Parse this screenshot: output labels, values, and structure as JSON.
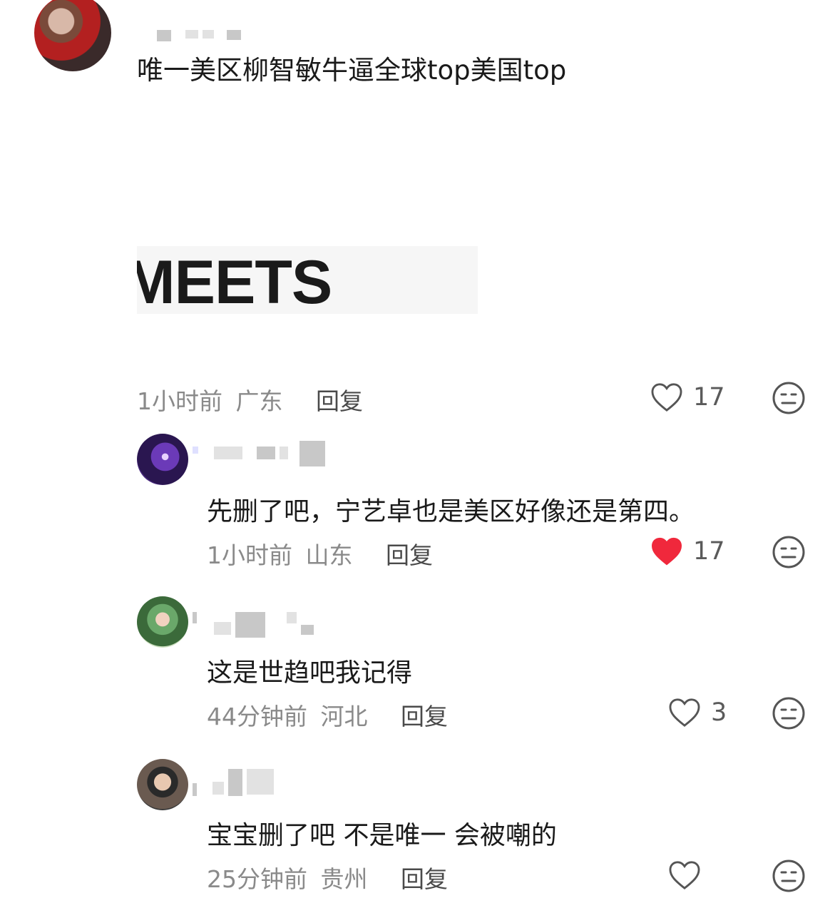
{
  "main_comment": {
    "text": "唯一美区柳智敏牛逼全球top美国top",
    "image_text": "MEETS KAR",
    "time": "1小时前",
    "location": "广东",
    "reply_label": "回复",
    "likes": "17",
    "liked": false
  },
  "replies": [
    {
      "text": "先删了吧，宁艺卓也是美区好像还是第四。",
      "time": "1小时前",
      "location": "山东",
      "reply_label": "回复",
      "likes": "17",
      "liked": true
    },
    {
      "text": "这是世趋吧我记得",
      "time": "44分钟前",
      "location": "河北",
      "reply_label": "回复",
      "likes": "3",
      "liked": false
    },
    {
      "text": "宝宝删了吧 不是唯一 会被嘲的",
      "time": "25分钟前",
      "location": "贵州",
      "reply_label": "回复",
      "likes": "",
      "liked": false
    }
  ],
  "icons": {
    "like": "heart-outline-icon",
    "liked": "heart-filled-icon",
    "dislike": "meh-face-icon"
  },
  "colors": {
    "liked_heart": "#f0283c",
    "meta_text": "#8a8a8a"
  }
}
